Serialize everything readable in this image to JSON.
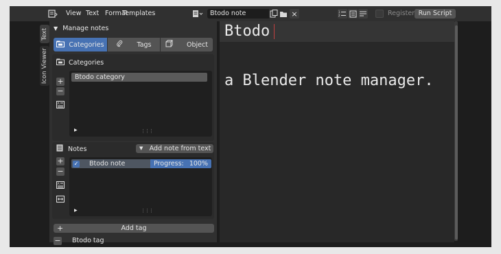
{
  "header": {
    "menus": [
      "View",
      "Text",
      "Format",
      "Templates"
    ],
    "text_name": "Btodo note",
    "register_label": "Register",
    "run_script_label": "Run Script"
  },
  "sidebar_tabs": [
    "Text",
    "Icon Viewer"
  ],
  "panel": {
    "title": "Manage notes",
    "segments": [
      "Categories",
      "Tags",
      "Object"
    ],
    "categories_label": "Categories",
    "categories_items": [
      "Btodo category"
    ],
    "notes_label": "Notes",
    "add_note_label": "Add note from text",
    "note_item": {
      "name": "Btodo note",
      "progress_label": "Progress:",
      "progress_value": "100%"
    },
    "add_tag_label": "Add tag",
    "tag_item": "Btodo tag"
  },
  "editor": {
    "line1": "Btodo",
    "line2": "a Blender note manager."
  },
  "colors": {
    "accent": "#4772b3",
    "cursor": "#c04040"
  }
}
